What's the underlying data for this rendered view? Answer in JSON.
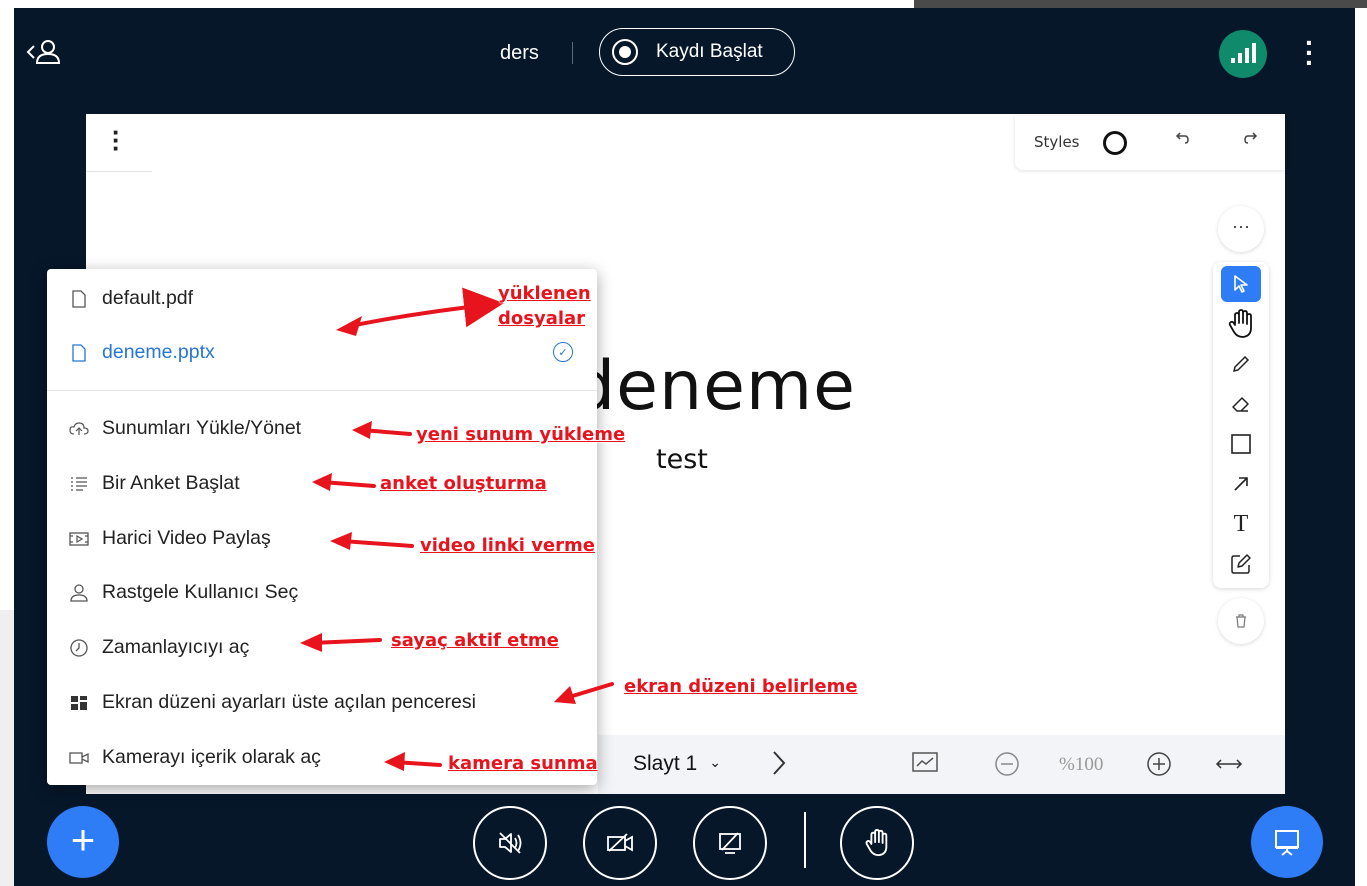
{
  "header": {
    "room_name": "ders",
    "record_label": "Kaydı Başlat"
  },
  "whiteboard": {
    "styles_label": "Styles",
    "more_label": "···",
    "slide": {
      "title": "deneme",
      "subtitle": "test"
    },
    "tools": [
      "select-icon",
      "hand-icon",
      "pencil-icon",
      "eraser-icon",
      "rectangle-icon",
      "arrow-icon",
      "text-icon",
      "note-icon"
    ],
    "active_tool": "select"
  },
  "slide_nav": {
    "current": "Slayt 1",
    "zoom": "%100"
  },
  "menu": {
    "files": [
      {
        "label": "default.pdf",
        "selected": false
      },
      {
        "label": "deneme.pptx",
        "selected": true
      }
    ],
    "actions": [
      {
        "label": "Sunumları Yükle/Yönet",
        "icon": "cloud-upload-icon"
      },
      {
        "label": "Bir Anket Başlat",
        "icon": "poll-icon"
      },
      {
        "label": "Harici Video Paylaş",
        "icon": "video-icon"
      },
      {
        "label": "Rastgele Kullanıcı Seç",
        "icon": "user-icon"
      },
      {
        "label": "Zamanlayıcıyı aç",
        "icon": "clock-icon"
      },
      {
        "label": "Ekran düzeni ayarları üste açılan penceresi",
        "icon": "layout-icon"
      },
      {
        "label": "Kamerayı içerik olarak aç",
        "icon": "camera-icon"
      }
    ]
  },
  "annotations": {
    "uploaded_files_1": "yüklenen",
    "uploaded_files_2": "dosyalar",
    "upload_new": "yeni sunum yükleme",
    "poll": "anket oluşturma",
    "video": "video linki verme",
    "timer": "sayaç aktif etme",
    "layout": "ekran düzeni belirleme",
    "camera": "kamera sunma"
  },
  "colors": {
    "background": "#06172a",
    "accent": "#2e7df6",
    "selected_item": "#2676d3",
    "annotation": "#e8141d",
    "connection": "#0f8b6c"
  }
}
